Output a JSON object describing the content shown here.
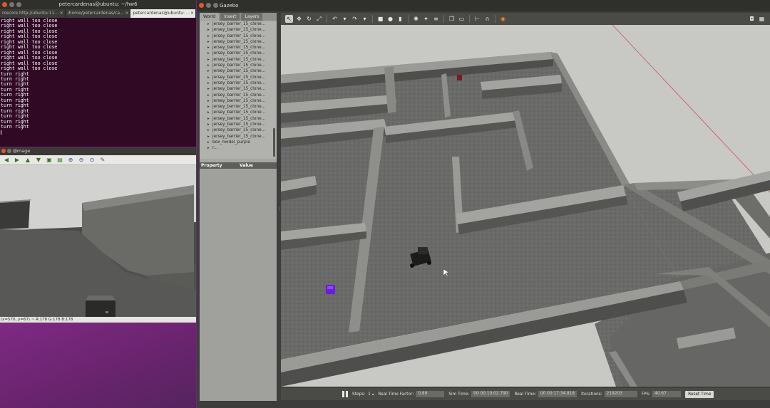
{
  "terminal": {
    "title": "petercardenas@ubuntu: ~/hw6",
    "tabs": [
      {
        "label": "roscore http://ubuntu:11...",
        "active": false
      },
      {
        "label": "/home/petercardenas/ca...",
        "active": false
      },
      {
        "label": "petercardenas@ubuntu: ...",
        "active": true
      }
    ],
    "lines": [
      "right wall too close",
      "right wall too close",
      "right wall too close",
      "right wall too close",
      "right wall too close",
      "right wall too close",
      "right wall too close",
      "right wall too close",
      "right wall too close",
      "right wall too close",
      "turn right",
      "turn right",
      "turn right",
      "turn right",
      "turn right",
      "turn right",
      "turn right",
      "turn right",
      "turn right",
      "turn right",
      "turn right"
    ]
  },
  "image_window": {
    "title": "image",
    "status": "(x=570, y=67) ~ R:178 G:178 B:178"
  },
  "gazebo": {
    "title": "Gazebo",
    "tabs": [
      "World",
      "Insert",
      "Layers"
    ],
    "tree_items": [
      "jersey_barrier_15_clone...",
      "jersey_barrier_15_clone...",
      "jersey_barrier_15_clone...",
      "jersey_barrier_15_clone...",
      "jersey_barrier_15_clone...",
      "jersey_barrier_15_clone...",
      "jersey_barrier_15_clone...",
      "jersey_barrier_15_clone...",
      "jersey_barrier_15_clone...",
      "jersey_barrier_15_clone...",
      "jersey_barrier_15_clone...",
      "jersey_barrier_15_clone...",
      "jersey_barrier_15_clone...",
      "jersey_barrier_15_clone...",
      "jersey_barrier_15_clone...",
      "jersey_barrier_15_clone...",
      "jersey_barrier_15_clone...",
      "jersey_barrier_15_clone...",
      "jersey_barrier_15_clone...",
      "jersey_barrier_15_clone...",
      "box_model_purple",
      "r..."
    ],
    "property_col": "Property",
    "value_col": "Value",
    "bottom": {
      "steps_label": "Steps:",
      "steps_value": "1",
      "rtf_label": "Real Time Factor:",
      "rtf_value": "0.89",
      "sim_label": "Sim Time:",
      "sim_value": "00 00:10:02.790",
      "real_label": "Real Time:",
      "real_value": "00 00:17:34.818",
      "iter_label": "Iterations:",
      "iter_value": "219203",
      "fps_label": "FPS:",
      "fps_value": "40.67",
      "reset_label": "Reset Time"
    }
  }
}
